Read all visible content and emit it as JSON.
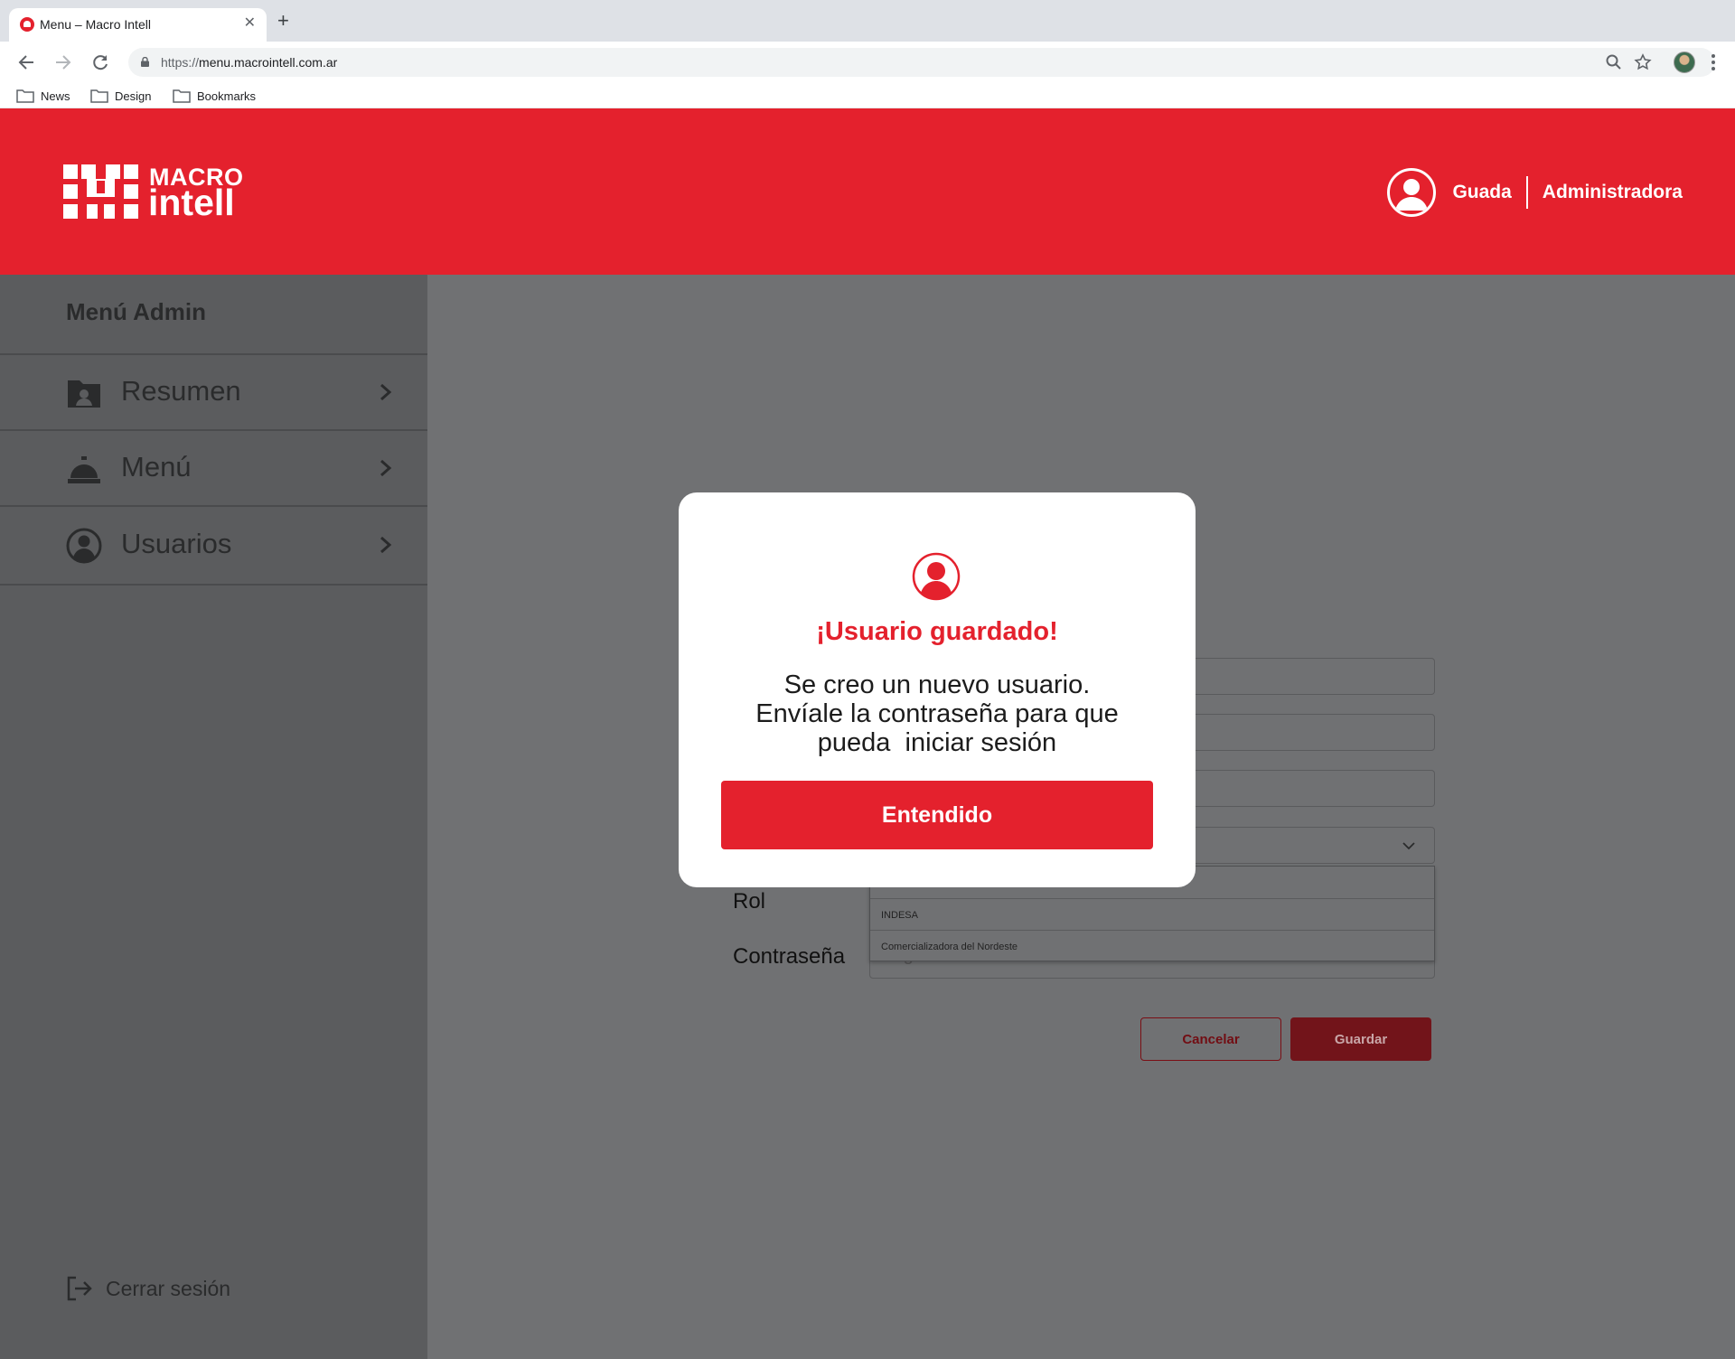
{
  "browser": {
    "tab_title": "Menu – Macro Intell",
    "tab_close": "✕",
    "new_tab": "+",
    "url_scheme": "https://",
    "url_host": "menu.macrointell.com.ar",
    "bookmarks": [
      {
        "label": "News"
      },
      {
        "label": "Design"
      },
      {
        "label": "Bookmarks"
      }
    ]
  },
  "header": {
    "logo_line1": "MACRO",
    "logo_line2": "intell",
    "user_name": "Guada",
    "user_role": "Administradora"
  },
  "sidebar": {
    "title": "Menú Admin",
    "items": [
      {
        "label": "Resumen",
        "icon": "user-folder-icon"
      },
      {
        "label": "Menú",
        "icon": "service-bell-icon"
      },
      {
        "label": "Usuarios",
        "icon": "user-circle-icon"
      }
    ],
    "logout_label": "Cerrar sesión"
  },
  "form": {
    "labels": {
      "rol": "Rol",
      "password": "Contraseña"
    },
    "dropdown_options": [
      "",
      "INDESA",
      "Comercializadora del Nordeste"
    ],
    "password_placeholder_partial": "Ingrese contraseña",
    "cancel_label": "Cancelar",
    "save_label": "Guardar"
  },
  "modal": {
    "title": "¡Usuario guardado!",
    "body_line1": "Se creo un nuevo usuario.",
    "body_line2": "Envíale la contraseña para que",
    "body_line3": "pueda  iniciar sesión",
    "button_label": "Entendido"
  },
  "colors": {
    "brand_red": "#e4212d",
    "overlay_dim": "#707173",
    "sidebar_dim": "#5b5c5e"
  }
}
